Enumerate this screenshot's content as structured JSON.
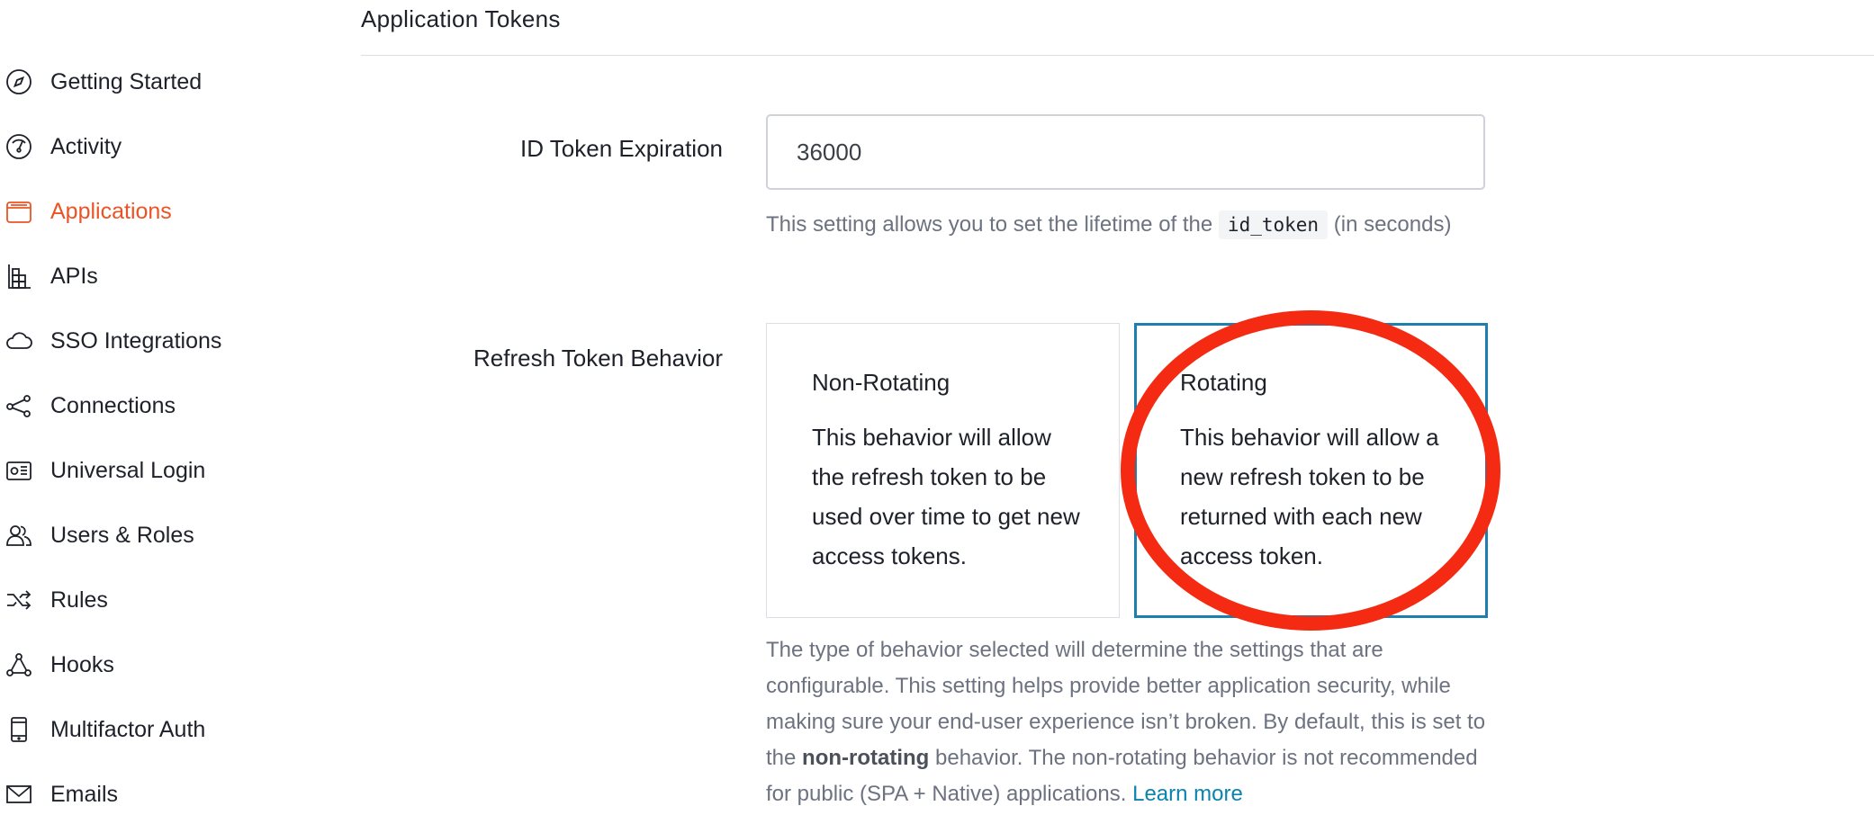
{
  "sidebar": {
    "items": [
      {
        "label": "Getting Started",
        "icon": "compass-icon",
        "active": false
      },
      {
        "label": "Activity",
        "icon": "gauge-icon",
        "active": false
      },
      {
        "label": "Applications",
        "icon": "applications-icon",
        "active": true
      },
      {
        "label": "APIs",
        "icon": "apis-icon",
        "active": false
      },
      {
        "label": "SSO Integrations",
        "icon": "cloud-icon",
        "active": false
      },
      {
        "label": "Connections",
        "icon": "share-nodes-icon",
        "active": false
      },
      {
        "label": "Universal Login",
        "icon": "login-card-icon",
        "active": false
      },
      {
        "label": "Users & Roles",
        "icon": "users-icon",
        "active": false
      },
      {
        "label": "Rules",
        "icon": "shuffle-icon",
        "active": false
      },
      {
        "label": "Hooks",
        "icon": "hooks-icon",
        "active": false
      },
      {
        "label": "Multifactor Auth",
        "icon": "phone-icon",
        "active": false
      },
      {
        "label": "Emails",
        "icon": "envelope-icon",
        "active": false
      }
    ],
    "active_color": "#eb5424"
  },
  "main": {
    "section_title": "Application Tokens",
    "id_token": {
      "label": "ID Token Expiration",
      "value": "36000",
      "help_prefix": "This setting allows you to set the lifetime of the ",
      "help_code": "id_token",
      "help_suffix": " (in seconds)"
    },
    "refresh": {
      "label": "Refresh Token Behavior",
      "options": [
        {
          "title": "Non-Rotating",
          "description": "This behavior will allow the refresh token to be used over time to get new access tokens.",
          "selected": false
        },
        {
          "title": "Rotating",
          "description": "This behavior will allow a new refresh token to be returned with each new access token.",
          "selected": true
        }
      ],
      "help_part1": "The type of behavior selected will determine the settings that are configurable. This setting helps provide better application security, while making sure your end-user experience isn’t broken. By default, this is set to the ",
      "help_bold": "non-rotating",
      "help_part2": " behavior. The non-rotating behavior is not recommended for public (SPA + Native) applications. ",
      "learn_more": "Learn more"
    }
  },
  "colors": {
    "selected_border": "#1d7fae",
    "annotation": "#f42a12",
    "link": "#0a84ae"
  }
}
